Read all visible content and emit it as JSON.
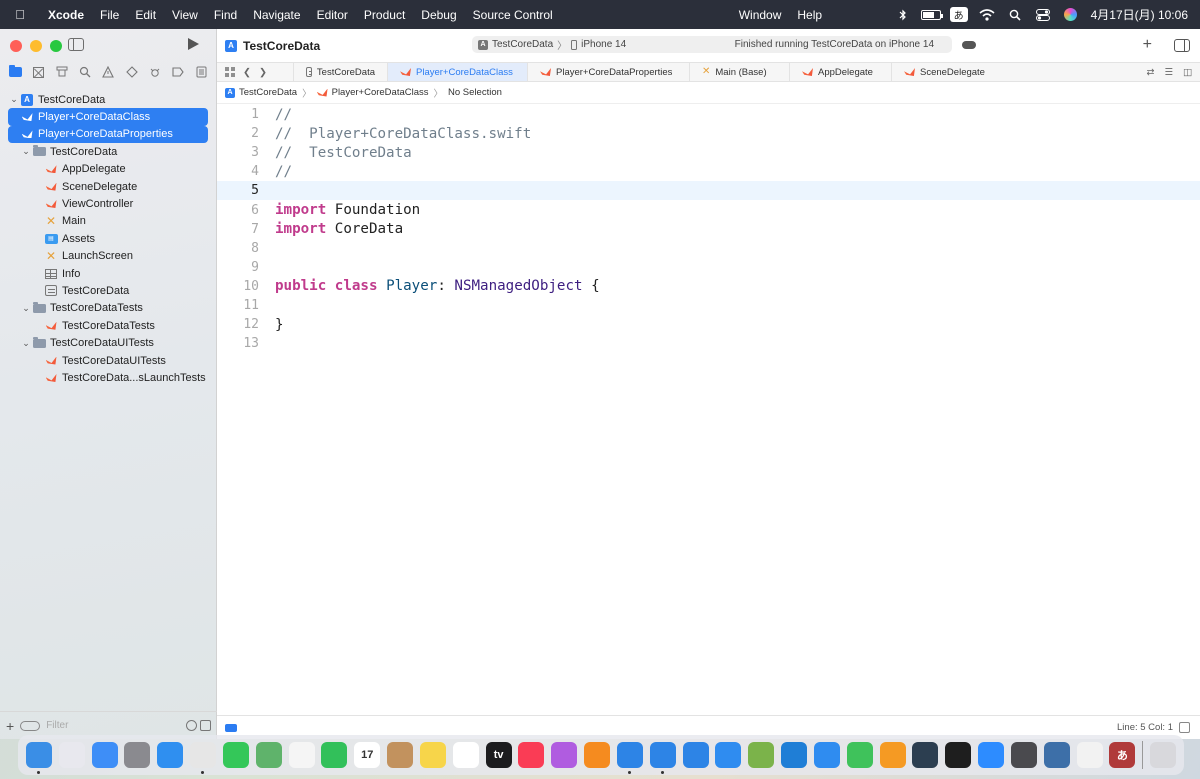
{
  "menubar": {
    "app_name": "Xcode",
    "items": [
      "File",
      "Edit",
      "View",
      "Find",
      "Navigate",
      "Editor",
      "Product",
      "Debug",
      "Source Control"
    ],
    "items_right": [
      "Window",
      "Help"
    ],
    "ime_label": "あ",
    "clock": "4月17日(月)  10:06"
  },
  "sidebar": {
    "filter_placeholder": "Filter",
    "tree": [
      {
        "label": "TestCoreData",
        "icon": "project-icon",
        "depth": 0,
        "disclosure": "v"
      },
      {
        "label": "Player+CoreDataClass",
        "icon": "swift-file-icon",
        "depth": 1,
        "selected": true
      },
      {
        "label": "Player+CoreDataProperties",
        "icon": "swift-file-icon",
        "depth": 1,
        "selected": true
      },
      {
        "label": "TestCoreData",
        "icon": "folder-icon",
        "depth": 1,
        "disclosure": "v"
      },
      {
        "label": "AppDelegate",
        "icon": "swift-file-icon",
        "depth": 2
      },
      {
        "label": "SceneDelegate",
        "icon": "swift-file-icon",
        "depth": 2
      },
      {
        "label": "ViewController",
        "icon": "swift-file-icon",
        "depth": 2
      },
      {
        "label": "Main",
        "icon": "storyboard-icon",
        "depth": 2
      },
      {
        "label": "Assets",
        "icon": "assets-icon",
        "depth": 2
      },
      {
        "label": "LaunchScreen",
        "icon": "storyboard-icon",
        "depth": 2
      },
      {
        "label": "Info",
        "icon": "plist-icon",
        "depth": 2
      },
      {
        "label": "TestCoreData",
        "icon": "data-model-icon",
        "depth": 2
      },
      {
        "label": "TestCoreDataTests",
        "icon": "folder-icon",
        "depth": 1,
        "disclosure": "v"
      },
      {
        "label": "TestCoreDataTests",
        "icon": "swift-file-icon",
        "depth": 2
      },
      {
        "label": "TestCoreDataUITests",
        "icon": "folder-icon",
        "depth": 1,
        "disclosure": "v"
      },
      {
        "label": "TestCoreDataUITests",
        "icon": "swift-file-icon",
        "depth": 2
      },
      {
        "label": "TestCoreData...sLaunchTests",
        "icon": "swift-file-icon",
        "depth": 2
      }
    ]
  },
  "toolbar": {
    "project_title": "TestCoreData",
    "scheme": "TestCoreData",
    "destination": "iPhone 14",
    "status": "Finished running TestCoreData on iPhone 14"
  },
  "tabs": [
    {
      "label": "TestCoreData",
      "icon": "data-model-icon"
    },
    {
      "label": "Player+CoreDataClass",
      "icon": "swift-file-icon",
      "active": true
    },
    {
      "label": "Player+CoreDataProperties",
      "icon": "swift-file-icon"
    },
    {
      "label": "Main (Base)",
      "icon": "storyboard-icon"
    },
    {
      "label": "AppDelegate",
      "icon": "swift-file-icon"
    },
    {
      "label": "SceneDelegate",
      "icon": "swift-file-icon"
    }
  ],
  "jumpbar": {
    "project": "TestCoreData",
    "file": "Player+CoreDataClass",
    "symbol": "No Selection"
  },
  "editor": {
    "current_line": 5,
    "lines": [
      {
        "n": "1",
        "tokens": [
          {
            "t": "//",
            "c": "cmt"
          }
        ]
      },
      {
        "n": "2",
        "tokens": [
          {
            "t": "//  Player+CoreDataClass.swift",
            "c": "cmt"
          }
        ]
      },
      {
        "n": "3",
        "tokens": [
          {
            "t": "//  TestCoreData",
            "c": "cmt"
          }
        ]
      },
      {
        "n": "4",
        "tokens": [
          {
            "t": "//",
            "c": "cmt"
          }
        ]
      },
      {
        "n": "5",
        "tokens": []
      },
      {
        "n": "6",
        "tokens": [
          {
            "t": "import",
            "c": "kw"
          },
          {
            "t": " Foundation",
            "c": "plain"
          }
        ]
      },
      {
        "n": "7",
        "tokens": [
          {
            "t": "import",
            "c": "kw"
          },
          {
            "t": " CoreData",
            "c": "plain"
          }
        ]
      },
      {
        "n": "8",
        "tokens": []
      },
      {
        "n": "9",
        "tokens": []
      },
      {
        "n": "10",
        "tokens": [
          {
            "t": "public",
            "c": "kw"
          },
          {
            "t": " ",
            "c": "plain"
          },
          {
            "t": "class",
            "c": "kw"
          },
          {
            "t": " ",
            "c": "plain"
          },
          {
            "t": "Player",
            "c": "typ"
          },
          {
            "t": ": ",
            "c": "plain"
          },
          {
            "t": "NSManagedObject",
            "c": "nsobj"
          },
          {
            "t": " {",
            "c": "plain"
          }
        ]
      },
      {
        "n": "11",
        "tokens": []
      },
      {
        "n": "12",
        "tokens": [
          {
            "t": "}",
            "c": "plain"
          }
        ]
      },
      {
        "n": "13",
        "tokens": []
      }
    ]
  },
  "statusbar": {
    "cursor": "Line: 5  Col: 1"
  },
  "dock": [
    {
      "name": "finder-icon",
      "color": "#3a8ee6",
      "running": true
    },
    {
      "name": "launchpad-icon",
      "color": "#e8e8ee"
    },
    {
      "name": "mail-icon",
      "color": "#3e8ef7"
    },
    {
      "name": "system-settings-icon",
      "color": "#8a8a8f"
    },
    {
      "name": "safari-icon",
      "color": "#2f8ff0"
    },
    {
      "name": "chrome-icon",
      "color": "#e6e6e6",
      "running": true
    },
    {
      "name": "messages-icon",
      "color": "#34c759"
    },
    {
      "name": "maps-icon",
      "color": "#5fb36b"
    },
    {
      "name": "photos-icon",
      "color": "#f5f5f5"
    },
    {
      "name": "facetime-icon",
      "color": "#32c05a"
    },
    {
      "name": "calendar-icon",
      "color": "#ffffff",
      "label": "17"
    },
    {
      "name": "contacts-icon",
      "color": "#c2925e"
    },
    {
      "name": "notes-icon",
      "color": "#f7d54a"
    },
    {
      "name": "reminders-icon",
      "color": "#ffffff"
    },
    {
      "name": "apple-tv-icon",
      "color": "#1c1c1e",
      "label": "tv"
    },
    {
      "name": "music-icon",
      "color": "#fa3c55"
    },
    {
      "name": "podcasts-icon",
      "color": "#b05ce0"
    },
    {
      "name": "books-icon",
      "color": "#f58b1f"
    },
    {
      "name": "xcode-icon",
      "color": "#2d84e6",
      "running": true
    },
    {
      "name": "simulator-icon",
      "color": "#2d84e6",
      "running": true
    },
    {
      "name": "developer-icon",
      "color": "#2d84e6"
    },
    {
      "name": "app-store-icon",
      "color": "#2f8cf0"
    },
    {
      "name": "script-editor-icon",
      "color": "#7bb34a"
    },
    {
      "name": "vscode-icon",
      "color": "#1f7ed6"
    },
    {
      "name": "keynote-icon",
      "color": "#2f8cf0"
    },
    {
      "name": "numbers-icon",
      "color": "#3fc25b"
    },
    {
      "name": "pages-icon",
      "color": "#f59a23"
    },
    {
      "name": "github-icon",
      "color": "#2c3e50"
    },
    {
      "name": "terminal-icon",
      "color": "#1e1e1e"
    },
    {
      "name": "zoom-icon",
      "color": "#2d8cff"
    },
    {
      "name": "calculator-icon",
      "color": "#4a4a4e"
    },
    {
      "name": "preview-icon",
      "color": "#3d6fa8"
    },
    {
      "name": "textedit-icon",
      "color": "#f2f2f2"
    },
    {
      "name": "dictionary-icon",
      "color": "#b03a3a",
      "label": "あ"
    },
    {
      "name": "trash-icon",
      "color": "#d8d8dc"
    }
  ]
}
